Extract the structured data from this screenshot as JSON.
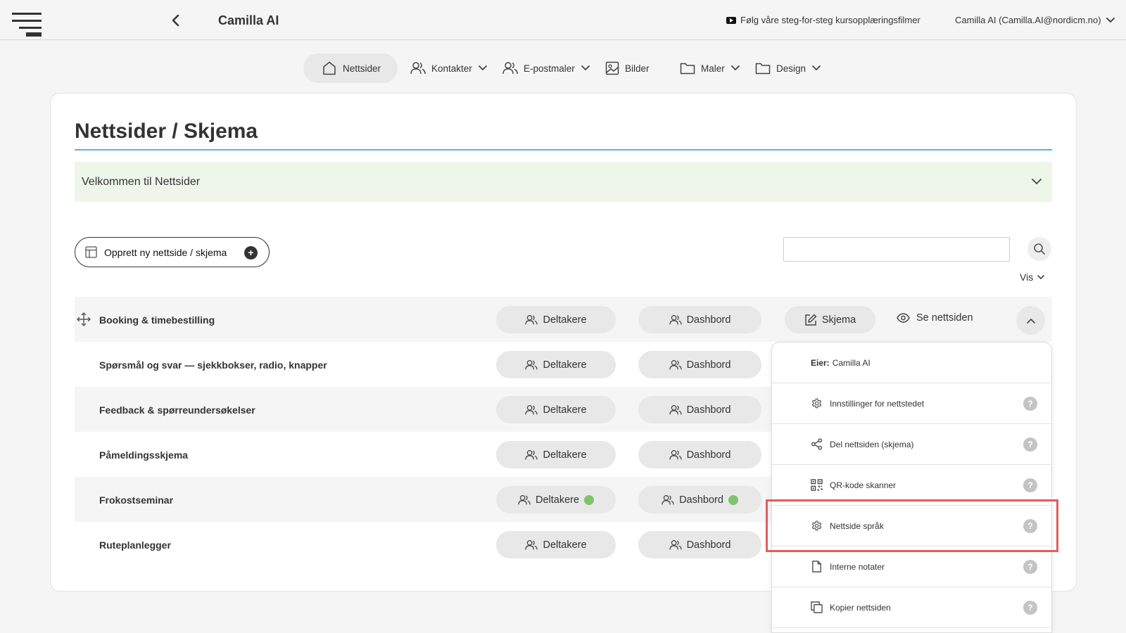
{
  "header": {
    "app_title": "Camilla AI",
    "tutorial_link": "Følg våre steg-for-steg kursopplæringsfilmer",
    "user_label": "Camilla AI (Camilla.AI@nordicm.no)"
  },
  "nav": {
    "items": [
      {
        "label": "Nettsider",
        "icon": "home-icon",
        "active": true
      },
      {
        "label": "Kontakter",
        "icon": "users-icon",
        "dropdown": true
      },
      {
        "label": "E-postmaler",
        "icon": "users-icon",
        "dropdown": true
      },
      {
        "label": "Bilder",
        "icon": "image-icon"
      },
      {
        "label": "Maler",
        "icon": "folder-icon",
        "dropdown": true
      },
      {
        "label": "Design",
        "icon": "folder-icon",
        "dropdown": true
      }
    ]
  },
  "page": {
    "title": "Nettsider / Skjema",
    "welcome": "Velkommen til Nettsider",
    "create_button": "Opprett ny nettside / skjema",
    "search_placeholder": "",
    "view_label": "Vis"
  },
  "row_actions": {
    "participants": "Deltakere",
    "dashboard": "Dashbord",
    "form": "Skjema",
    "view_site": "Se nettsiden"
  },
  "rows": [
    {
      "name": "Booking & timebestilling",
      "shaded": true,
      "status_dots": false
    },
    {
      "name": "Spørsmål og svar — sjekkbokser, radio, knapper",
      "shaded": false,
      "status_dots": false
    },
    {
      "name": "Feedback & spørreundersøkelser",
      "shaded": true,
      "status_dots": false
    },
    {
      "name": "Påmeldingsskjema",
      "shaded": false,
      "status_dots": false
    },
    {
      "name": "Frokostseminar",
      "shaded": true,
      "status_dots": true
    },
    {
      "name": "Ruteplanlegger",
      "shaded": false,
      "status_dots": false
    }
  ],
  "dropdown": {
    "owner_label": "Eier:",
    "owner_name": "Camilla AI",
    "items": [
      {
        "label": "Innstillinger for nettstedet",
        "icon": "gear-icon"
      },
      {
        "label": "Del nettsiden (skjema)",
        "icon": "share-icon"
      },
      {
        "label": "QR-kode skanner",
        "icon": "qr-code-icon"
      },
      {
        "label": "Nettside språk",
        "icon": "gear-icon",
        "highlighted": true
      },
      {
        "label": "Interne notater",
        "icon": "document-icon"
      },
      {
        "label": "Kopier nettsiden",
        "icon": "copy-icon"
      }
    ],
    "help_symbol": "?"
  },
  "colors": {
    "accent_rule": "#5bb6d0",
    "welcome_bg": "#eef6ea",
    "status_green": "#7dc46b",
    "highlight_red": "#e35d5d",
    "pill_bg": "#e8e8e8"
  }
}
